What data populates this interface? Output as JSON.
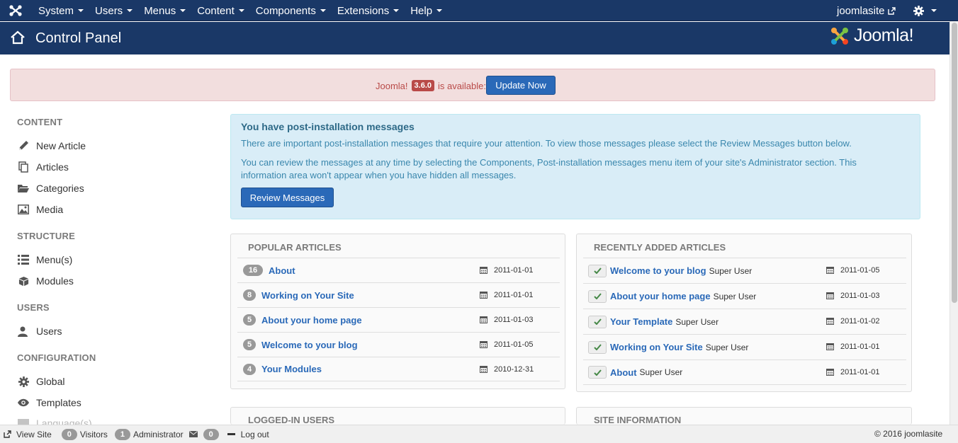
{
  "nav": {
    "menus": [
      "System",
      "Users",
      "Menus",
      "Content",
      "Components",
      "Extensions",
      "Help"
    ],
    "site_name": "joomlasite"
  },
  "header": {
    "title": "Control Panel",
    "brand": "Joomla!"
  },
  "update": {
    "prefix": "Joomla!",
    "version": "3.6.0",
    "suffix": "is available:",
    "button": "Update Now"
  },
  "sidebar": {
    "content_heading": "CONTENT",
    "new_article": "New Article",
    "articles": "Articles",
    "categories": "Categories",
    "media": "Media",
    "structure_heading": "STRUCTURE",
    "menus": "Menu(s)",
    "modules": "Modules",
    "users_heading": "USERS",
    "users": "Users",
    "configuration_heading": "CONFIGURATION",
    "global": "Global",
    "templates": "Templates",
    "languages": "Language(s)"
  },
  "postinstall": {
    "title": "You have post-installation messages",
    "p1": "There are important post-installation messages that require your attention. To view those messages please select the Review Messages button below.",
    "p2": "You can review the messages at any time by selecting the Components, Post-installation messages menu item of your site's Administrator section. This information area won't appear when you have hidden all messages.",
    "button": "Review Messages"
  },
  "popular": {
    "title": "POPULAR ARTICLES",
    "items": [
      {
        "hits": "16",
        "title": "About",
        "date": "2011-01-01"
      },
      {
        "hits": "8",
        "title": "Working on Your Site",
        "date": "2011-01-01"
      },
      {
        "hits": "5",
        "title": "About your home page",
        "date": "2011-01-03"
      },
      {
        "hits": "5",
        "title": "Welcome to your blog",
        "date": "2011-01-05"
      },
      {
        "hits": "4",
        "title": "Your Modules",
        "date": "2010-12-31"
      }
    ]
  },
  "recent": {
    "title": "RECENTLY ADDED ARTICLES",
    "items": [
      {
        "title": "Welcome to your blog",
        "author": "Super User",
        "date": "2011-01-05"
      },
      {
        "title": "About your home page",
        "author": "Super User",
        "date": "2011-01-03"
      },
      {
        "title": "Your Template",
        "author": "Super User",
        "date": "2011-01-02"
      },
      {
        "title": "Working on Your Site",
        "author": "Super User",
        "date": "2011-01-01"
      },
      {
        "title": "About",
        "author": "Super User",
        "date": "2011-01-01"
      }
    ]
  },
  "logged_in": {
    "title": "LOGGED-IN USERS"
  },
  "site_info": {
    "title": "SITE INFORMATION"
  },
  "status": {
    "view_site": "View Site",
    "visitors_count": "0",
    "visitors_label": "Visitors",
    "admin_count": "1",
    "admin_label": "Administrator",
    "messages_count": "0",
    "logout": "Log out",
    "copyright": "© 2016 joomlasite"
  },
  "colors": {
    "nav_bg": "#1a3867",
    "primary_button": "#2a69b8",
    "alert_bg": "#f2dede",
    "info_bg": "#d9edf7",
    "link": "#2a69b8",
    "success_check": "#468847"
  }
}
